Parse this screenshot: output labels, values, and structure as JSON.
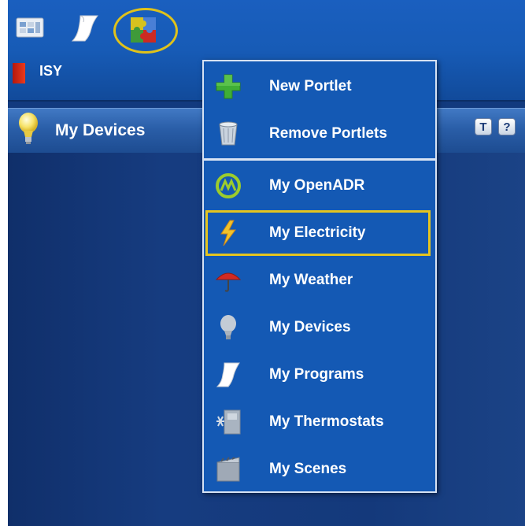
{
  "toolbar": {
    "icons": [
      "dashboard-icon",
      "scroll-icon",
      "puzzle-icon"
    ],
    "logo_label": "ISY"
  },
  "portlet": {
    "title": "My Devices",
    "buttons": [
      "T",
      "?"
    ]
  },
  "menu": {
    "items": [
      {
        "label": "New Portlet",
        "icon": "plus-icon"
      },
      {
        "label": "Remove Portlets",
        "icon": "trash-icon"
      },
      {
        "label": "My OpenADR",
        "icon": "openadr-icon"
      },
      {
        "label": "My Electricity",
        "icon": "lightning-icon",
        "highlighted": true
      },
      {
        "label": "My Weather",
        "icon": "umbrella-icon"
      },
      {
        "label": "My Devices",
        "icon": "bulb-icon"
      },
      {
        "label": "My Programs",
        "icon": "scroll-icon"
      },
      {
        "label": "My Thermostats",
        "icon": "thermostat-icon"
      },
      {
        "label": "My Scenes",
        "icon": "scenes-icon"
      }
    ]
  },
  "colors": {
    "accent_highlight": "#e5c51f",
    "menu_bg": "#1459b4",
    "toolbar_bg": "#175bb6",
    "portlet_body": "#14397b"
  }
}
